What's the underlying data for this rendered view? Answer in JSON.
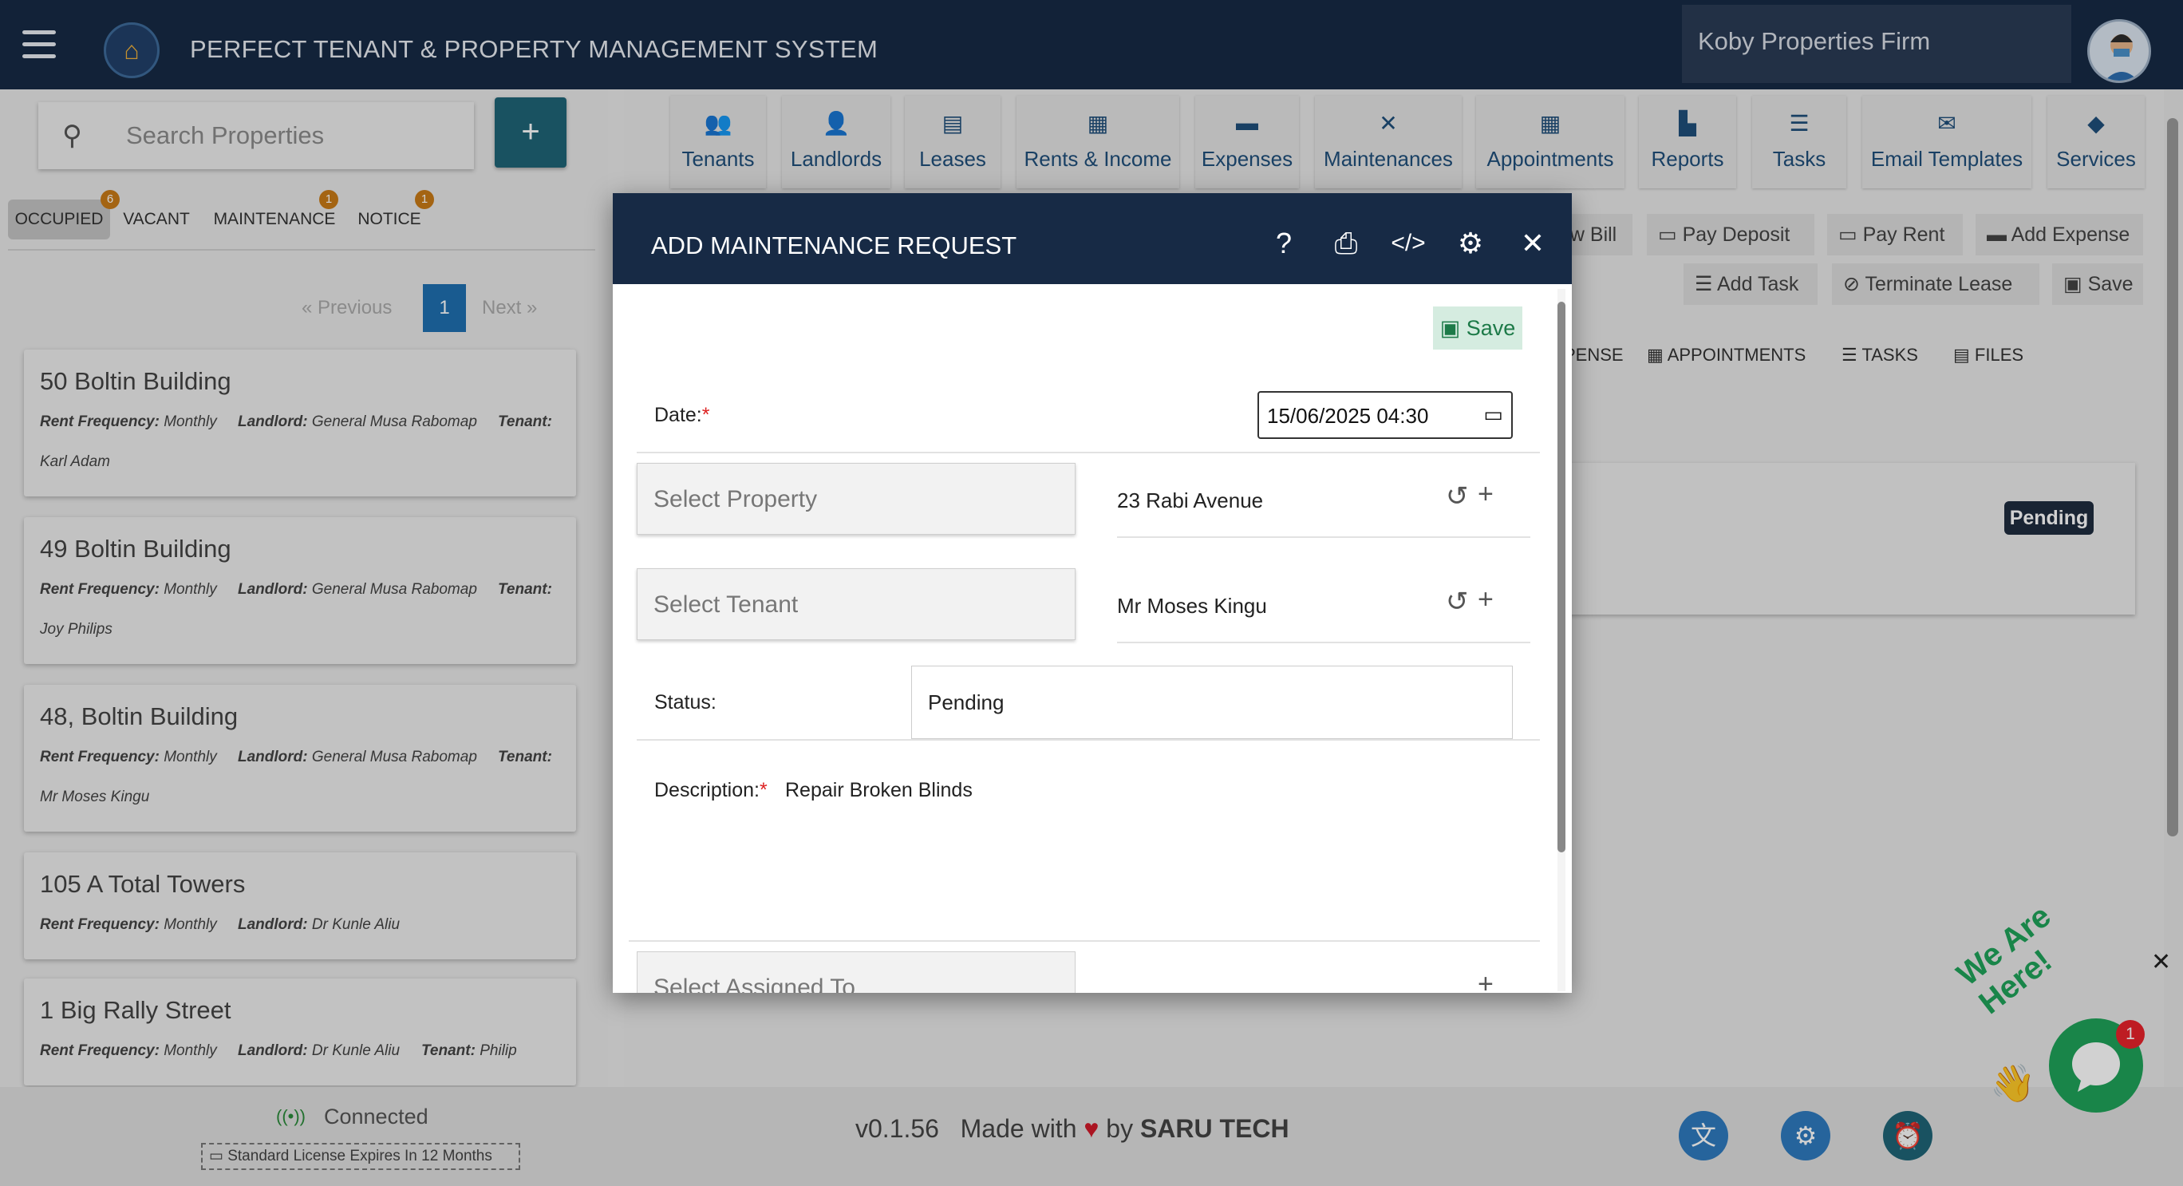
{
  "header": {
    "app_title": "PERFECT TENANT & PROPERTY MANAGEMENT SYSTEM",
    "firm_name": "Koby Properties Firm"
  },
  "sidebar": {
    "search_placeholder": "Search Properties",
    "add_label": "+",
    "filter_tabs": [
      {
        "label": "OCCUPIED",
        "badge": "6"
      },
      {
        "label": "VACANT",
        "badge": ""
      },
      {
        "label": "MAINTENANCE",
        "badge": "1"
      },
      {
        "label": "NOTICE",
        "badge": "1"
      }
    ],
    "pager": {
      "prev": "« Previous",
      "current": "1",
      "next": "Next »"
    },
    "properties": [
      {
        "title": "50 Boltin Building",
        "freq_label": "Rent Frequency:",
        "freq": "Monthly",
        "landlord_label": "Landlord:",
        "landlord": "General Musa Rabomap",
        "tenant_label": "Tenant:",
        "tenant": "Karl Adam"
      },
      {
        "title": "49 Boltin Building",
        "freq_label": "Rent Frequency:",
        "freq": "Monthly",
        "landlord_label": "Landlord:",
        "landlord": "General Musa Rabomap",
        "tenant_label": "Tenant:",
        "tenant": "Joy Philips"
      },
      {
        "title": "48, Boltin Building",
        "freq_label": "Rent Frequency:",
        "freq": "Monthly",
        "landlord_label": "Landlord:",
        "landlord": "General Musa Rabomap",
        "tenant_label": "Tenant:",
        "tenant": "Mr Moses Kingu"
      },
      {
        "title": "105 A Total Towers",
        "freq_label": "Rent Frequency:",
        "freq": "Monthly",
        "landlord_label": "Landlord:",
        "landlord": "Dr Kunle Aliu",
        "tenant_label": "",
        "tenant": ""
      },
      {
        "title": "1 Big Rally Street",
        "freq_label": "Rent Frequency:",
        "freq": "Monthly",
        "landlord_label": "Landlord:",
        "landlord": "Dr Kunle Aliu",
        "tenant_label": "Tenant:",
        "tenant": "Philip"
      }
    ]
  },
  "nav": [
    {
      "label": "Tenants",
      "icon": "users-icon"
    },
    {
      "label": "Landlords",
      "icon": "user-icon"
    },
    {
      "label": "Leases",
      "icon": "file-icon"
    },
    {
      "label": "Rents & Income",
      "icon": "cash-register-icon"
    },
    {
      "label": "Expenses",
      "icon": "wallet-icon"
    },
    {
      "label": "Maintenances",
      "icon": "tools-icon"
    },
    {
      "label": "Appointments",
      "icon": "calendar-icon"
    },
    {
      "label": "Reports",
      "icon": "chart-icon"
    },
    {
      "label": "Tasks",
      "icon": "tasks-icon"
    },
    {
      "label": "Email Templates",
      "icon": "envelope-icon"
    },
    {
      "label": "Services",
      "icon": "tag-icon"
    }
  ],
  "actions": {
    "row1": [
      "ew Bill",
      "Pay Deposit",
      "Pay Rent",
      "Add Expense"
    ],
    "row2": [
      "Add Task",
      "Terminate Lease",
      "Save"
    ]
  },
  "subtabs": [
    "PENSE",
    "APPOINTMENTS",
    "TASKS",
    "FILES"
  ],
  "status_badge": "Pending",
  "modal": {
    "title": "ADD MAINTENANCE REQUEST",
    "save_label": "Save",
    "date_label": "Date:",
    "required_mark": "*",
    "date_value": "15/06/2025 04:30",
    "property_placeholder": "Select  Property",
    "property_value": "23 Rabi Avenue",
    "tenant_placeholder": "Select  Tenant",
    "tenant_value": "Mr Moses Kingu",
    "status_label": "Status:",
    "status_value": "Pending",
    "description_label": "Description:",
    "description_value": "Repair Broken Blinds",
    "assigned_placeholder": "Select  Assigned To"
  },
  "footer": {
    "connected": "Connected",
    "license": "Standard License Expires In 12 Months",
    "version": "v0.1.56",
    "made_with": "Made with",
    "by": "by",
    "company": "SARU TECH"
  },
  "chat": {
    "banner": "We Are Here!",
    "badge": "1"
  }
}
